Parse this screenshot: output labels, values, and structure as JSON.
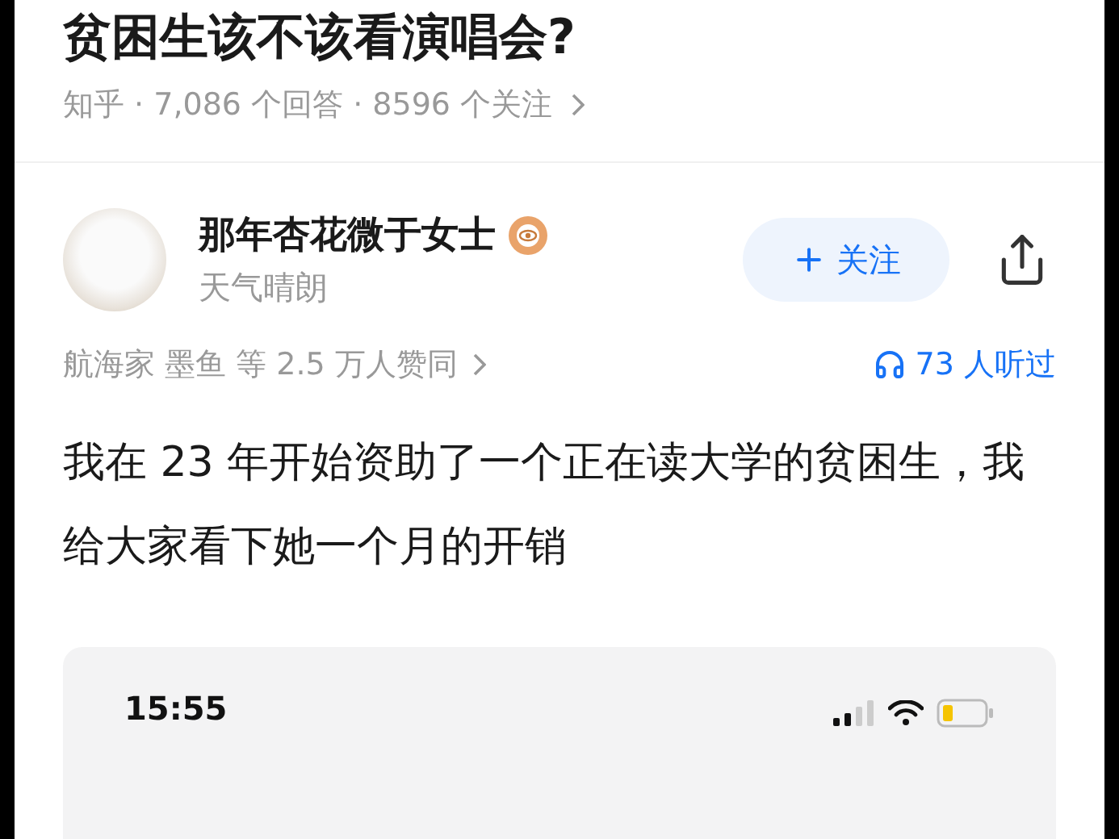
{
  "question": {
    "title": "贫困生该不该看演唱会?",
    "meta": "知乎 · 7,086 个回答 · 8596 个关注"
  },
  "author": {
    "name": "那年杏花微于女士",
    "bio": "天气晴朗",
    "follow_label": "关注"
  },
  "stats": {
    "upvotes": "航海家 墨鱼 等 2.5 万人赞同",
    "listens": "73 人听过"
  },
  "answer": {
    "text": "我在 23 年开始资助了一个正在读大学的贫困生，我给大家看下她一个月的开销"
  },
  "embedded_screenshot": {
    "time": "15:55"
  }
}
